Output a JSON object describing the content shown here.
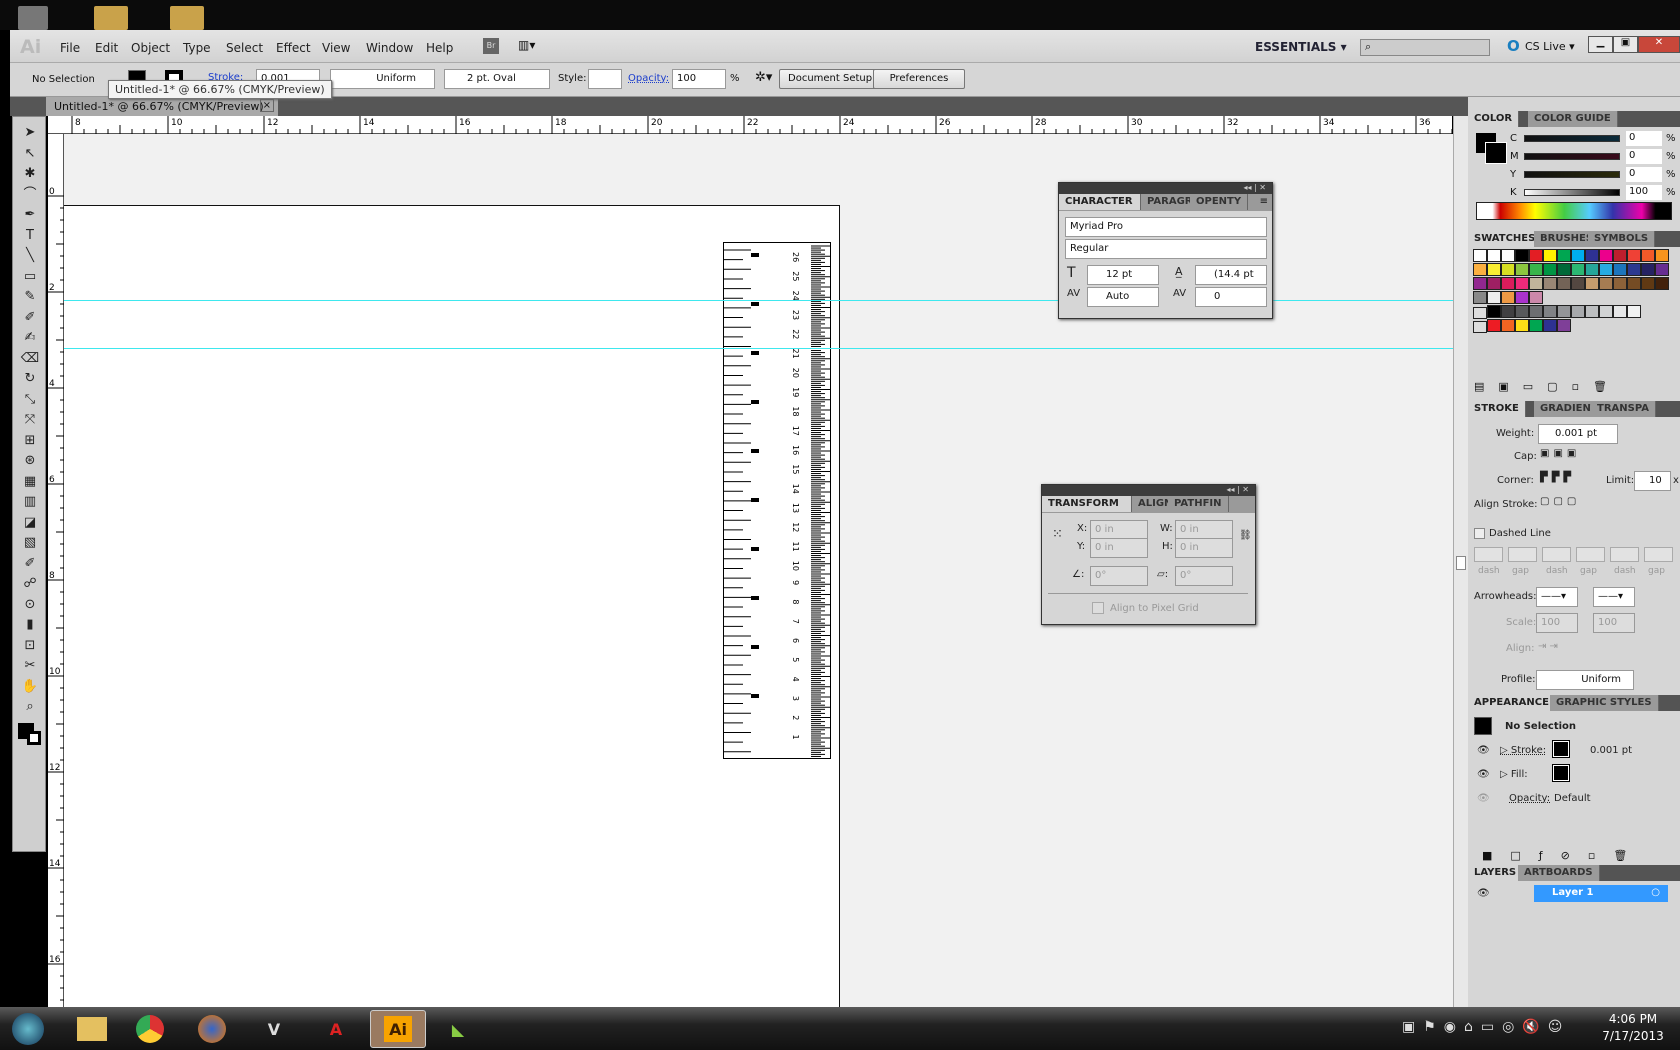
{
  "menubar": {
    "logo": "Ai",
    "items": [
      "File",
      "Edit",
      "Object",
      "Type",
      "Select",
      "Effect",
      "View",
      "Window",
      "Help"
    ],
    "bridge": "Br",
    "workspace": "ESSENTIALS",
    "search_placeholder": "",
    "cs_live": "CS Live"
  },
  "control": {
    "selection": "No Selection",
    "stroke_label": "Stroke:",
    "stroke_value": "0.001",
    "profile": "Uniform",
    "brush": "2 pt. Oval",
    "style_label": "Style:",
    "opacity_label": "Opacity:",
    "opacity_value": "100",
    "percent": "%",
    "document_setup": "Document Setup",
    "preferences": "Preferences"
  },
  "tooltip": "Untitled-1* @ 66.67% (CMYK/Preview)",
  "document_tab": {
    "title": "Untitled-1* @ 66.67% (CMYK/Preview)",
    "close": "×"
  },
  "rulers": {
    "horizontal": [
      "8",
      "10",
      "12",
      "14",
      "16",
      "18",
      "20",
      "22",
      "24",
      "26",
      "28",
      "30",
      "32",
      "34",
      "36"
    ],
    "vertical": [
      "0",
      "2",
      "4",
      "6",
      "8",
      "10",
      "12",
      "14",
      "16"
    ]
  },
  "ruler_artwork": {
    "cm_labels": [
      "26",
      "25",
      "24",
      "23",
      "22",
      "21",
      "20",
      "19",
      "18",
      "17",
      "16",
      "15",
      "14",
      "13",
      "12",
      "11",
      "10",
      "9",
      "8",
      "7",
      "6",
      "5",
      "4",
      "3",
      "2",
      "1"
    ]
  },
  "character_panel": {
    "tabs": [
      "CHARACTER",
      "PARAGR",
      "OPENTY"
    ],
    "font_family": "Myriad Pro",
    "font_style": "Regular",
    "size": "12 pt",
    "leading": "(14.4 pt",
    "kerning": "Auto",
    "tracking": "0"
  },
  "transform_panel": {
    "tabs": [
      "TRANSFORM",
      "ALIGN",
      "PATHFIN"
    ],
    "x_label": "X:",
    "x": "0 in",
    "y_label": "Y:",
    "y": "0 in",
    "w_label": "W:",
    "w": "0 in",
    "h_label": "H:",
    "h": "0 in",
    "rotate": "0°",
    "shear": "0°",
    "align_pixel": "Align to Pixel Grid"
  },
  "color_panel": {
    "tabs": [
      "COLOR",
      "COLOR GUIDE"
    ],
    "channels": [
      {
        "label": "C",
        "value": "0"
      },
      {
        "label": "M",
        "value": "0"
      },
      {
        "label": "Y",
        "value": "0"
      },
      {
        "label": "K",
        "value": "100"
      }
    ],
    "unit": "%"
  },
  "swatches_panel": {
    "tabs": [
      "SWATCHES",
      "BRUSHES",
      "SYMBOLS"
    ],
    "rows": [
      [
        "#ffffff",
        "#ffffff",
        "#ffffff",
        "#000000",
        "#e31e24",
        "#fff200",
        "#00a651",
        "#00aeef",
        "#2e3192",
        "#ec008c",
        "#be1e2d",
        "#ef4136",
        "#f15a29",
        "#f7941d"
      ],
      [
        "#fbb040",
        "#f9ed32",
        "#d7df23",
        "#8dc63f",
        "#39b54a",
        "#009444",
        "#006838",
        "#2bb673",
        "#26a69a",
        "#27aae1",
        "#1c75bc",
        "#2b3990",
        "#262262",
        "#662d91"
      ],
      [
        "#92278f",
        "#9e1f63",
        "#da1c5c",
        "#ee2a7b",
        "#c2b59b",
        "#998675",
        "#736357",
        "#534741",
        "#c69c6d",
        "#a67c52",
        "#8c6239",
        "#754c24",
        "#603913",
        "#42210b"
      ]
    ],
    "grays": [
      "#000000",
      "#414042",
      "#58595b",
      "#6d6e71",
      "#808285",
      "#939598",
      "#a7a9ac",
      "#bcbec0",
      "#d1d3d4",
      "#e6e7e8",
      "#f1f2f2"
    ],
    "brights": [
      "#ed1c24",
      "#f26522",
      "#ffde17",
      "#00a651",
      "#2e3192",
      "#7f3f98"
    ]
  },
  "stroke_panel": {
    "tabs": [
      "STROKE",
      "GRADIENT",
      "TRANSPA"
    ],
    "weight_label": "Weight:",
    "weight": "0.001 pt",
    "cap_label": "Cap:",
    "corner_label": "Corner:",
    "limit_label": "Limit:",
    "limit": "10",
    "limit_unit": "x",
    "align_label": "Align Stroke:",
    "dashed": "Dashed Line",
    "dash_labels": [
      "dash",
      "gap",
      "dash",
      "gap",
      "dash",
      "gap"
    ],
    "arrowheads": "Arrowheads:",
    "scale_label": "Scale:",
    "scale1": "100",
    "scale2": "100",
    "align2": "Align:",
    "profile_label": "Profile:",
    "profile": "Uniform"
  },
  "appearance_panel": {
    "tabs": [
      "APPEARANCE",
      "GRAPHIC STYLES"
    ],
    "title": "No Selection",
    "stroke_label": "Stroke:",
    "stroke_value": "0.001 pt",
    "fill_label": "Fill:",
    "opacity_label": "Opacity:",
    "opacity_value": "Default"
  },
  "layers_panel": {
    "tabs": [
      "LAYERS",
      "ARTBOARDS"
    ],
    "layer": "Layer 1",
    "highlight": "#3399ff"
  },
  "taskbar": {
    "time": "4:06 PM",
    "date": "7/17/2013",
    "active_app": "Ai"
  }
}
